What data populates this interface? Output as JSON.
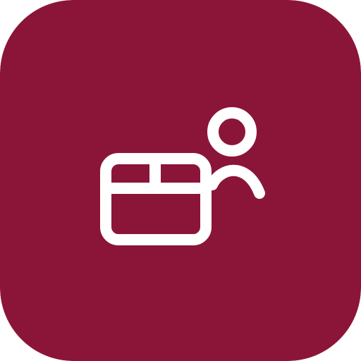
{
  "icon": {
    "name": "board-user-icon",
    "background_color": "#8B1538",
    "glyph_color": "#FFFFFF"
  }
}
